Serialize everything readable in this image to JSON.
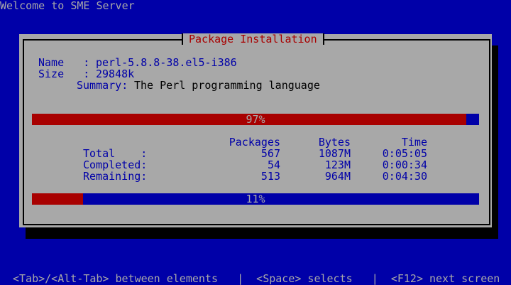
{
  "header": {
    "title": "Welcome to SME Server"
  },
  "dialog": {
    "title": "Package Installation",
    "name_label": "Name   :",
    "name_value": "perl-5.8.8-38.el5-i386",
    "size_label": "Size   :",
    "size_value": "29848k",
    "summary_label": "Summary:",
    "summary_value": "The Perl programming language",
    "package_progress": {
      "percent": 97,
      "label": "97%"
    },
    "table": {
      "headers": [
        "Packages",
        "Bytes",
        "Time"
      ],
      "rows": [
        {
          "label": "Total    :",
          "packages": "567",
          "bytes": "1087M",
          "time": "0:05:05"
        },
        {
          "label": "Completed:",
          "packages": "54",
          "bytes": "123M",
          "time": "0:00:34"
        },
        {
          "label": "Remaining:",
          "packages": "513",
          "bytes": "964M",
          "time": "0:04:30"
        }
      ]
    },
    "overall_progress": {
      "percent": 11,
      "label": "11%"
    }
  },
  "footer": {
    "help": "<Tab>/<Alt-Tab> between elements   |  <Space> selects   |  <F12> next screen"
  },
  "colors": {
    "background": "#0000a8",
    "dialog": "#a8a8a8",
    "accent": "#a80000"
  }
}
